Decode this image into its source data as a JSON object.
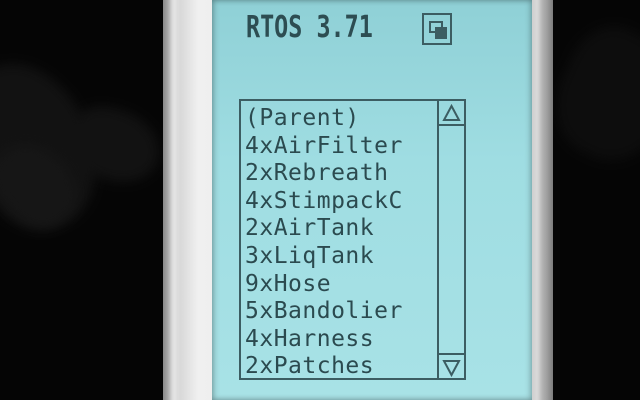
{
  "header": {
    "title": "RTOS 3.71"
  },
  "inventory": {
    "items": [
      {
        "label": "(Parent)"
      },
      {
        "label": "4xAirFilter"
      },
      {
        "label": "2xRebreath"
      },
      {
        "label": "4xStimpackC"
      },
      {
        "label": "2xAirTank"
      },
      {
        "label": "3xLiqTank"
      },
      {
        "label": "9xHose"
      },
      {
        "label": "5xBandolier"
      },
      {
        "label": "4xHarness"
      },
      {
        "label": "2xPatches"
      }
    ]
  },
  "icons": {
    "window": "window-toggle-icon",
    "scroll_up": "triangle-up-icon",
    "scroll_down": "triangle-down-icon"
  },
  "colors": {
    "screen": "#9fdde2",
    "ink": "#2b4a4f",
    "casing": "#e2e2e2"
  }
}
